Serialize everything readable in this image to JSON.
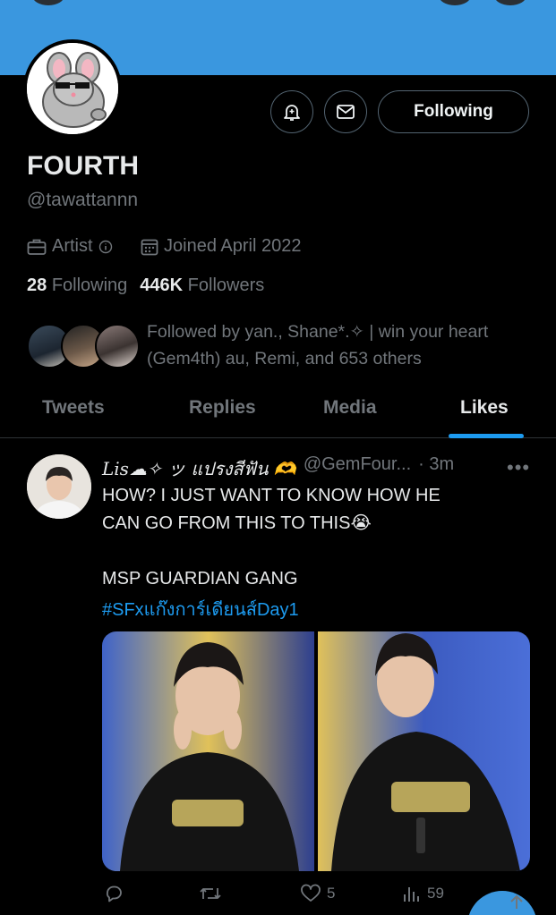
{
  "profile": {
    "name": "FOURTH",
    "handle": "@tawattannn",
    "category": "Artist",
    "joined": "Joined April 2022",
    "following_count": "28",
    "following_label": "Following",
    "followers_count": "446K",
    "followers_label": "Followers",
    "follow_button": "Following",
    "followed_by": "Followed by yan., Shane*.✧ | win your heart (Gem4th) au, Remi, and 653 others"
  },
  "tabs": [
    {
      "label": "Tweets",
      "active": false
    },
    {
      "label": "Replies",
      "active": false
    },
    {
      "label": "Media",
      "active": false
    },
    {
      "label": "Likes",
      "active": true
    }
  ],
  "tweet": {
    "author": "Lis☁✧ ッ แปรงสีฟัน 🫶",
    "handle": "@GemFour...",
    "time": "· 3m",
    "text": "HOW? I JUST WANT TO KNOW HOW HE\nCAN GO FROM THIS TO THIS😭\n\nMSP GUARDIAN GANG",
    "hashtag": "#SFxแก๊งการ์เดียนส์Day1",
    "actions": {
      "replies": "",
      "retweets": "",
      "likes": "5",
      "views": "59"
    }
  },
  "icons": [
    "bell-plus-icon",
    "mail-icon",
    "briefcase-icon",
    "info-icon",
    "calendar-icon",
    "more-icon",
    "reply-icon",
    "retweet-icon",
    "heart-icon",
    "views-icon",
    "share-icon"
  ],
  "colors": {
    "accent": "#1d9bf0",
    "banner": "#3a97df",
    "background": "#000000",
    "muted_text": "#71767b",
    "primary_text": "#e7e9ea",
    "border": "#2f3336"
  }
}
